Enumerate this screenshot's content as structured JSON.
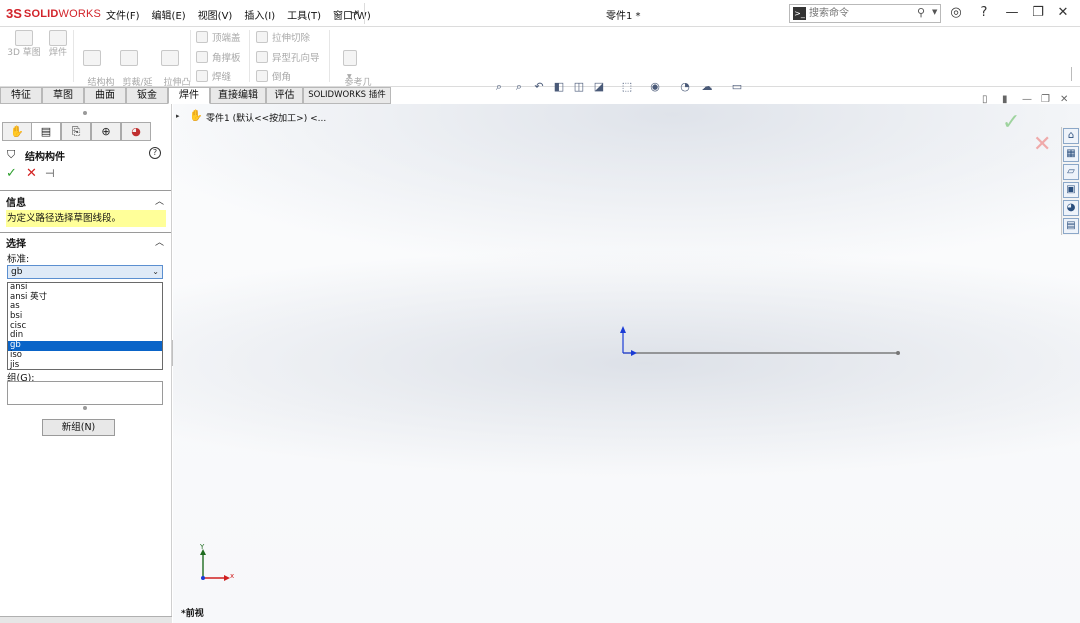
{
  "app": {
    "logo_mark": "3S",
    "logo_text": "SOLID",
    "logo_text2": "WORKS",
    "menu": [
      "文件(F)",
      "编辑(E)",
      "视图(V)",
      "插入(I)",
      "工具(T)",
      "窗口(W)"
    ],
    "doc_title": "零件1 *",
    "search_placeholder": "搜索命令"
  },
  "commands": {
    "big": [
      {
        "label": "3D 草图",
        "icon": "3d-sketch-icon"
      },
      {
        "label": "焊件",
        "icon": "weldment-icon"
      },
      {
        "label": "结构构\n件",
        "icon": "structural-member-icon"
      },
      {
        "label": "剪裁/延\n伸",
        "icon": "trim-extend-icon"
      },
      {
        "label": "拉伸凸\n台/基体",
        "icon": "extruded-boss-icon"
      },
      {
        "label": "参考几\n何体",
        "icon": "reference-geometry-icon"
      }
    ],
    "small": [
      {
        "label": "顶端盖",
        "icon": "end-cap-icon"
      },
      {
        "label": "角撑板",
        "icon": "gusset-icon"
      },
      {
        "label": "焊缝",
        "icon": "weld-bead-icon"
      },
      {
        "label": "拉伸切除",
        "icon": "extruded-cut-icon"
      },
      {
        "label": "异型孔向导",
        "icon": "hole-wizard-icon"
      },
      {
        "label": "倒角",
        "icon": "chamfer-icon"
      }
    ]
  },
  "tabs": [
    {
      "label": "特征",
      "active": false
    },
    {
      "label": "草图",
      "active": false
    },
    {
      "label": "曲面",
      "active": false
    },
    {
      "label": "钣金",
      "active": false
    },
    {
      "label": "焊件",
      "active": true
    },
    {
      "label": "直接编辑",
      "active": false
    },
    {
      "label": "评估",
      "active": false
    },
    {
      "label": "SOLIDWORKS 插件",
      "active": false
    }
  ],
  "property_manager": {
    "title": "结构构件",
    "info_header": "信息",
    "info_message": "为定义路径选择草图线段。",
    "selection_header": "选择",
    "standard_label": "标准:",
    "standard_value": "gb",
    "standard_options": [
      "ansi",
      "ansi 英寸",
      "as",
      "bsi",
      "cisc",
      "din",
      "gb",
      "iso",
      "jis"
    ],
    "standard_selected_index": 6,
    "group_label": "组(G):",
    "new_group_button": "新组(N)"
  },
  "feature_tree": {
    "root_label": "零件1 (默认<<按加工>) <..."
  },
  "view": {
    "orientation_label": "*前视",
    "triad_x": "x",
    "triad_y": "Y"
  },
  "colors": {
    "accent_blue": "#0a64c8",
    "info_yellow": "#ffff99",
    "ok_green": "#2e9f2e",
    "cancel_red": "#d32020",
    "brand_red": "#d2232a"
  }
}
